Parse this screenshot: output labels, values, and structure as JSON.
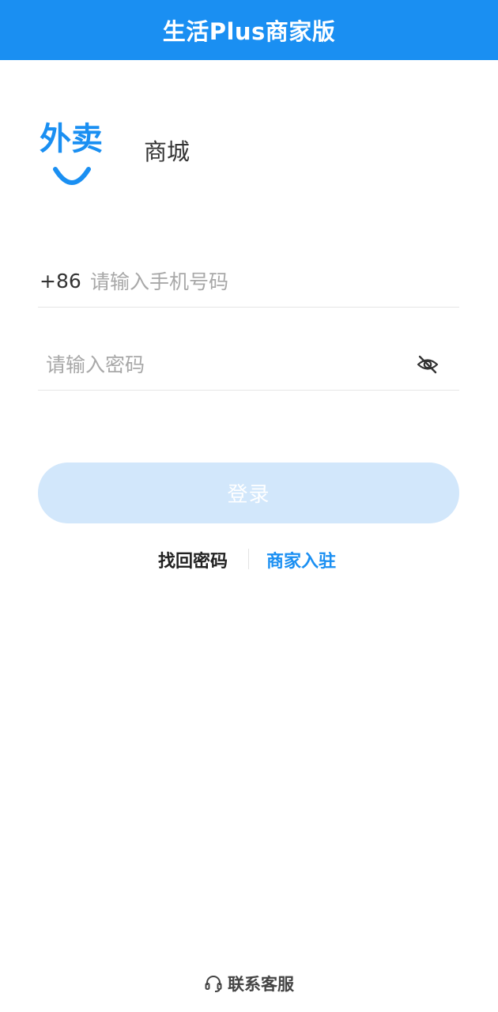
{
  "header": {
    "title": "生活Plus商家版"
  },
  "tabs": [
    {
      "label": "外卖",
      "active": true
    },
    {
      "label": "商城",
      "active": false
    }
  ],
  "form": {
    "phone": {
      "country_code": "+86",
      "placeholder": "请输入手机号码",
      "value": ""
    },
    "password": {
      "placeholder": "请输入密码",
      "value": "",
      "toggle_icon": "eye-off-icon"
    }
  },
  "login_button": {
    "label": "登录",
    "enabled": false
  },
  "links": {
    "recover_password": "找回密码",
    "merchant_register": "商家入驻"
  },
  "support": {
    "icon": "headset-icon",
    "label": "联系客服"
  },
  "colors": {
    "primary": "#1a8ff2",
    "button_disabled": "#d2e7fb",
    "placeholder": "#a8a8a8",
    "divider": "#e6e6e6"
  }
}
